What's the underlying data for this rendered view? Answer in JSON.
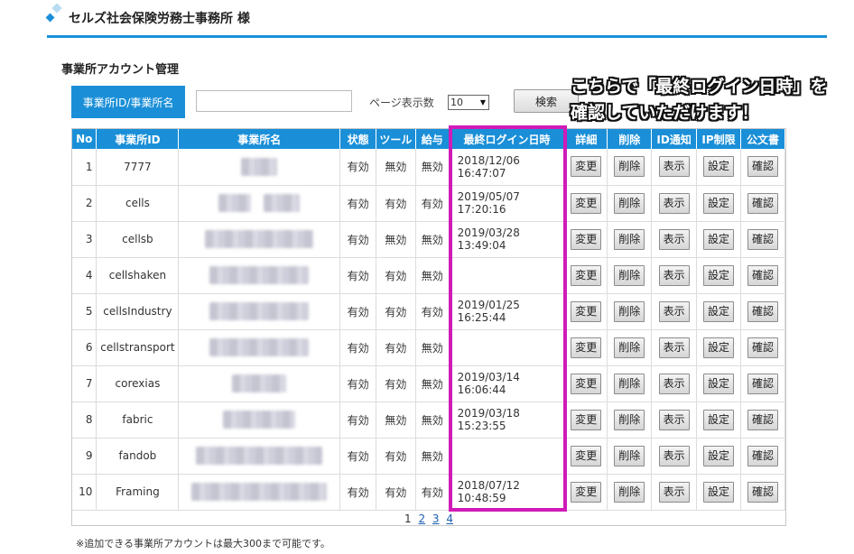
{
  "header": {
    "title": "セルズ社会保険労務士事務所 様",
    "logo_icon": "diamond-logo-icon",
    "accent_color": "#1a8fd8"
  },
  "section_title": "事業所アカウント管理",
  "search": {
    "label": "事業所ID/事業所名",
    "input_value": "",
    "page_size_label": "ページ表示数",
    "page_size_value": "10",
    "button_label": "検索"
  },
  "callout": {
    "line1": "こちらで「最終ログイン日時」を",
    "line2": "確認していただけます！",
    "highlight_color": "#d01bb8"
  },
  "table": {
    "columns": [
      "No",
      "事業所ID",
      "事業所名",
      "状態",
      "ツール",
      "給与",
      "最終ログイン日時",
      "詳細",
      "削除",
      "ID通知",
      "IP制限",
      "公文書"
    ],
    "action_labels": {
      "detail": "変更",
      "delete": "削除",
      "notify": "表示",
      "ip": "設定",
      "docs": "確認"
    },
    "rows": [
      {
        "no": "1",
        "id": "7777",
        "name": "",
        "state": "有効",
        "tool": "無効",
        "salary": "無効",
        "login": "2018/12/06 16:47:07"
      },
      {
        "no": "2",
        "id": "cells",
        "name": "",
        "state": "有効",
        "tool": "有効",
        "salary": "有効",
        "login": "2019/05/07 17:20:16"
      },
      {
        "no": "3",
        "id": "cellsb",
        "name": "",
        "state": "有効",
        "tool": "無効",
        "salary": "無効",
        "login": "2019/03/28 13:49:04"
      },
      {
        "no": "4",
        "id": "cellshaken",
        "name": "",
        "state": "有効",
        "tool": "有効",
        "salary": "無効",
        "login": ""
      },
      {
        "no": "5",
        "id": "cellsIndustry",
        "name": "",
        "state": "有効",
        "tool": "有効",
        "salary": "有効",
        "login": "2019/01/25 16:25:44"
      },
      {
        "no": "6",
        "id": "cellstransport",
        "name": "",
        "state": "有効",
        "tool": "有効",
        "salary": "無効",
        "login": ""
      },
      {
        "no": "7",
        "id": "corexias",
        "name": "",
        "state": "有効",
        "tool": "有効",
        "salary": "無効",
        "login": "2019/03/14 16:06:44"
      },
      {
        "no": "8",
        "id": "fabric",
        "name": "",
        "state": "有効",
        "tool": "無効",
        "salary": "無効",
        "login": "2019/03/18 15:23:55"
      },
      {
        "no": "9",
        "id": "fandob",
        "name": "",
        "state": "有効",
        "tool": "有効",
        "salary": "無効",
        "login": ""
      },
      {
        "no": "10",
        "id": "Framing",
        "name": "",
        "state": "有効",
        "tool": "有効",
        "salary": "有効",
        "login": "2018/07/12 10:48:59"
      }
    ]
  },
  "pagination": {
    "current": "1",
    "pages": [
      "2",
      "3",
      "4"
    ]
  },
  "footer_note": "※追加できる事業所アカウントは最大300まで可能です。"
}
